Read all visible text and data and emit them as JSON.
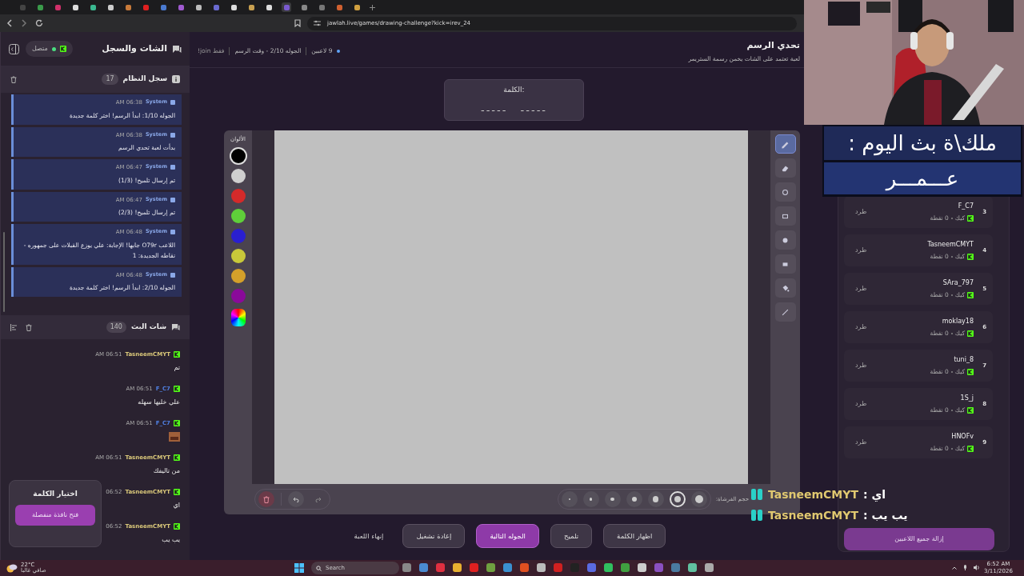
{
  "browser": {
    "url": "jawlah.live/games/drawing-challenge?kick=irev_24"
  },
  "sidebar": {
    "title": "الشات والسجل",
    "status": "متصل",
    "system_log": {
      "title": "سجل النظام",
      "count": "17",
      "messages": [
        {
          "user": "System",
          "time": "06:38 AM",
          "text": "الجوله 1/10: ابدأ الرسم! اختر كلمة جديدة"
        },
        {
          "user": "System",
          "time": "06:38 AM",
          "text": "بدأت لعبة تحدي الرسم"
        },
        {
          "user": "System",
          "time": "06:47 AM",
          "text": "تم إرسال تلميح! (1/3)"
        },
        {
          "user": "System",
          "time": "06:47 AM",
          "text": "تم إرسال تلميح! (2/3)"
        },
        {
          "user": "System",
          "time": "06:48 AM",
          "text": "اللاعب O79r جابها! الإجابة: علي يوزع القبلات على جمهوره - نقاطه الجديدة: 1"
        },
        {
          "user": "System",
          "time": "06:48 AM",
          "text": "الجوله 2/10: ابدأ الرسم! اختر كلمة جديدة"
        }
      ]
    },
    "stream_chat": {
      "title": "شات البث",
      "count": "140",
      "messages": [
        {
          "kind": "text",
          "user": "TasneemCMYT",
          "color": "#d9c77a",
          "time": "06:51 AM",
          "text": "تم"
        },
        {
          "kind": "text",
          "user": "F_C7",
          "color": "#4f7fe0",
          "time": "06:51 AM",
          "text": "علي خليها سهله"
        },
        {
          "kind": "emote",
          "user": "F_C7",
          "color": "#4f7fe0",
          "time": "06:51 AM"
        },
        {
          "kind": "text",
          "user": "TasneemCMYT",
          "color": "#d9c77a",
          "time": "06:51 AM",
          "text": "من تاليفك"
        },
        {
          "kind": "text",
          "user": "TasneemCMYT",
          "color": "#d9c77a",
          "time": "06:52",
          "text": "اي"
        },
        {
          "kind": "text",
          "user": "TasneemCMYT",
          "color": "#d9c77a",
          "time": "06:52",
          "text": "يب يب"
        }
      ]
    },
    "word_popup": {
      "title": "اختيار الكلمة",
      "button": "فتح نافذة منفصلة"
    }
  },
  "game": {
    "title": "تحدي الرسم",
    "subtitle": "لعبة تعتمد على الشات يخمن رسمة الستريمر",
    "players": "9 لاعبين",
    "round": "الجوله 2/10 - وقت الرسم",
    "join": "فقط join!",
    "word_label": "الكلمة:",
    "word_pattern": "----- -----",
    "colors_label": "الألوان",
    "colors": [
      {
        "kind": "swatch",
        "color": "#000000",
        "selected": true
      },
      {
        "kind": "swatch",
        "color": "#cfcfcf",
        "selected": false
      },
      {
        "kind": "swatch",
        "color": "#d42a2a",
        "selected": false
      },
      {
        "kind": "swatch",
        "color": "#5fcf3a",
        "selected": false
      },
      {
        "kind": "swatch",
        "color": "#2a1fd0",
        "selected": false
      },
      {
        "kind": "swatch",
        "color": "#c8c83a",
        "selected": false
      },
      {
        "kind": "swatch",
        "color": "#d4a02a",
        "selected": false
      },
      {
        "kind": "swatch",
        "color": "#8a0a9a",
        "selected": false
      },
      {
        "kind": "picker",
        "selected": false
      }
    ],
    "tools": [
      {
        "kind": "pencil",
        "selected": true
      },
      {
        "kind": "eraser",
        "selected": false
      },
      {
        "kind": "circle",
        "selected": false
      },
      {
        "kind": "rect",
        "selected": false
      },
      {
        "kind": "filled-circle",
        "selected": false
      },
      {
        "kind": "filled-rect",
        "selected": false
      },
      {
        "kind": "bucket",
        "selected": false
      },
      {
        "kind": "line",
        "selected": false
      }
    ],
    "brush_label": "حجم الفرشاة:",
    "brush_sizes": [
      {
        "selected": false
      },
      {
        "selected": true
      },
      {
        "selected": false
      },
      {
        "selected": false
      },
      {
        "selected": false
      },
      {
        "selected": false
      },
      {
        "selected": false
      }
    ],
    "actions": [
      {
        "kind": "button",
        "label": "اظهار الكلمة",
        "selected": false
      },
      {
        "kind": "button",
        "label": "تلميح",
        "selected": false
      },
      {
        "kind": "button",
        "label": "الجوله التالية",
        "selected": true
      },
      {
        "kind": "button",
        "label": "إعادة تشغيل",
        "selected": false
      },
      {
        "kind": "link",
        "label": "إنهاء اللعبة",
        "selected": false
      }
    ]
  },
  "players": {
    "items": [
      {
        "rank": "3",
        "name": "F_C7",
        "platform": "كيك",
        "points": "0 نقطة",
        "kick": "طرد"
      },
      {
        "rank": "4",
        "name": "TasneemCMYT",
        "platform": "كيك",
        "points": "0 نقطة",
        "kick": "طرد"
      },
      {
        "rank": "5",
        "name": "SAra_797",
        "platform": "كيك",
        "points": "0 نقطة",
        "kick": "طرد"
      },
      {
        "rank": "6",
        "name": "moklay18",
        "platform": "كيك",
        "points": "0 نقطة",
        "kick": "طرد"
      },
      {
        "rank": "7",
        "name": "tuni_8",
        "platform": "كيك",
        "points": "0 نقطة",
        "kick": "طرد"
      },
      {
        "rank": "8",
        "name": "1S_j",
        "platform": "كيك",
        "points": "0 نقطة",
        "kick": "طرد"
      },
      {
        "rank": "9",
        "name": "HNOFv",
        "platform": "كيك",
        "points": "0 نقطة",
        "kick": "طرد"
      }
    ],
    "remove_all": "إزالة جميع اللاعبين"
  },
  "stream_overlay": {
    "banner_title": "ملك\\ة بث اليوم :",
    "banner_name": "عـــمـــر",
    "chat": [
      {
        "user": "TasneemCMYT",
        "text": ": اي"
      },
      {
        "user": "TasneemCMYT",
        "text": ": يب يب"
      }
    ]
  },
  "taskbar": {
    "temperature": "22°C",
    "weather": "صافي غالبا",
    "search": "Search",
    "time": "6:52 AM",
    "date": "3/11/2026"
  }
}
